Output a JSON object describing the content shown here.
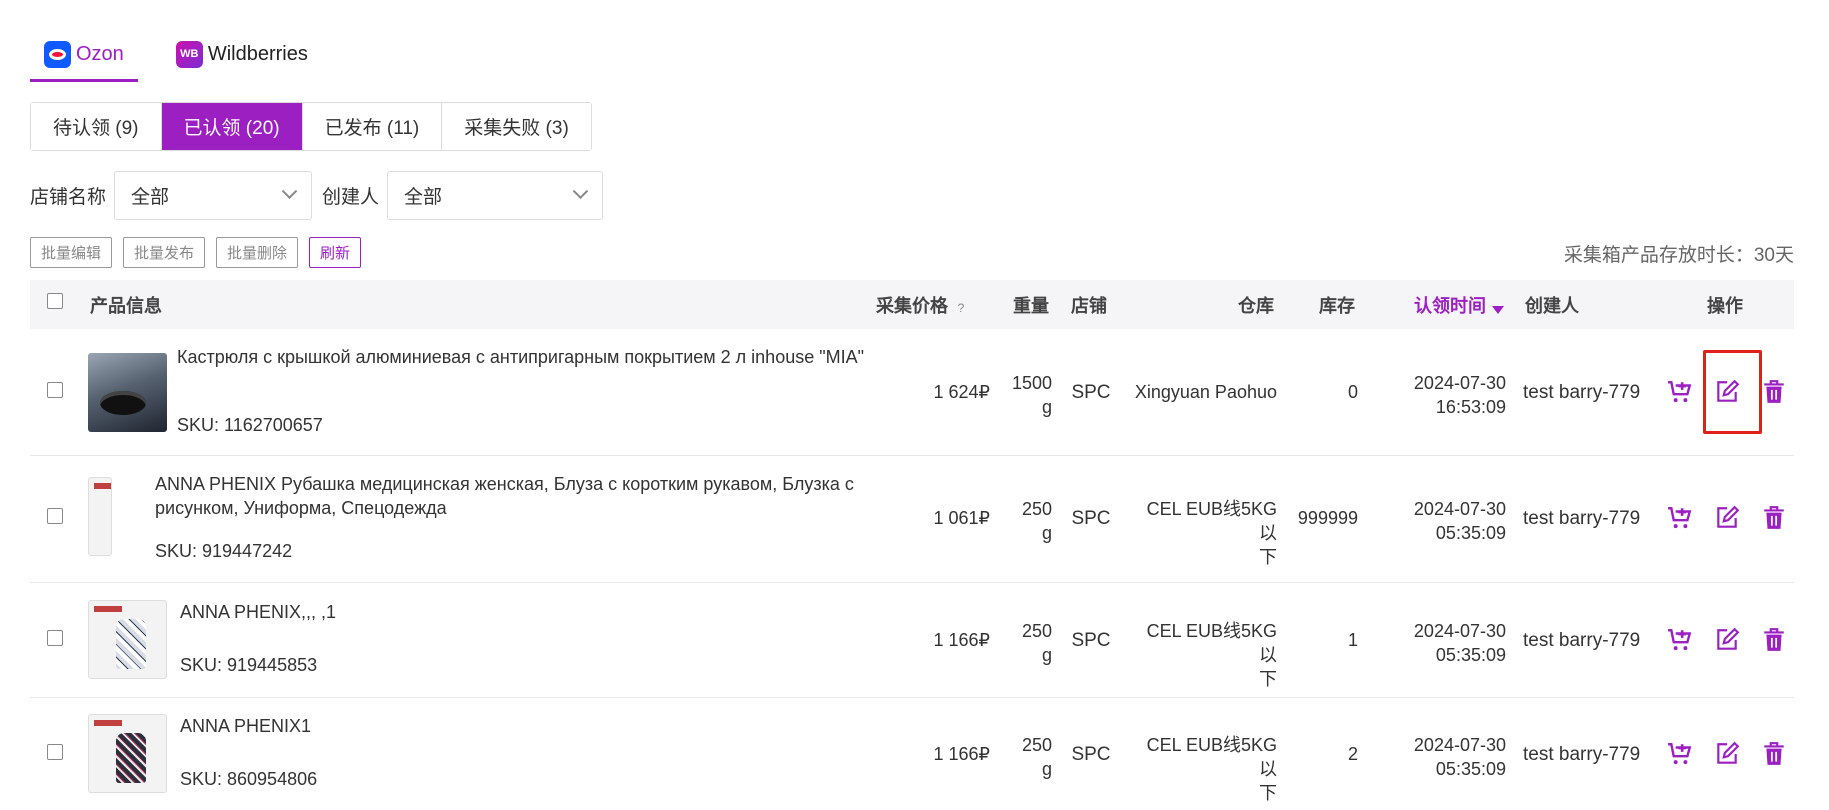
{
  "platform_tabs": [
    {
      "label": "Ozon",
      "logo": "ozon-logo",
      "active": true
    },
    {
      "label": "Wildberries",
      "logo_text": "WB",
      "active": false
    }
  ],
  "status_tabs": [
    {
      "label": "待认领 (9)",
      "active": false
    },
    {
      "label": "已认领 (20)",
      "active": true
    },
    {
      "label": "已发布 (11)",
      "active": false
    },
    {
      "label": "采集失败 (3)",
      "active": false
    }
  ],
  "filters": {
    "shop_label": "店铺名称",
    "shop_value": "全部",
    "creator_label": "创建人",
    "creator_value": "全部"
  },
  "actions": {
    "batch_edit": "批量编辑",
    "batch_publish": "批量发布",
    "batch_delete": "批量删除",
    "refresh": "刷新"
  },
  "storage_note": "采集箱产品存放时长：30天",
  "table": {
    "headers": {
      "product_info": "产品信息",
      "price": "采集价格",
      "price_help": "?",
      "weight": "重量",
      "shop": "店铺",
      "warehouse": "仓库",
      "stock": "库存",
      "claim_time": "认领时间",
      "creator": "创建人",
      "operations": "操作"
    },
    "rows": [
      {
        "name": "Кастрюля с крышкой алюминиевая с антипригарным покрытием 2 л inhouse \"MIA\"",
        "sku": "SKU: 1162700657",
        "price": "1 624₽",
        "weight_value": "1500",
        "weight_unit": "g",
        "shop": "SPC",
        "warehouse": "Xingyuan Paohuo",
        "stock": "0",
        "date": "2024-07-30",
        "time": "16:53:09",
        "creator": "test barry-779"
      },
      {
        "name": "ANNA PHENIX Рубашка медицинская женская, Блуза с коротким рукавом, Блузка с рисунком, Униформа, Спецодежда",
        "sku": "SKU: 919447242",
        "price": "1 061₽",
        "weight_value": "250",
        "weight_unit": "g",
        "shop": "SPC",
        "warehouse_line1": "CEL EUB线5KG以",
        "warehouse_line2": "下",
        "stock": "999999",
        "date": "2024-07-30",
        "time": "05:35:09",
        "creator": "test barry-779"
      },
      {
        "name": "ANNA PHENIX,,, ,1",
        "sku": "SKU: 919445853",
        "price": "1 166₽",
        "weight_value": "250",
        "weight_unit": "g",
        "shop": "SPC",
        "warehouse_line1": "CEL EUB线5KG以",
        "warehouse_line2": "下",
        "stock": "1",
        "date": "2024-07-30",
        "time": "05:35:09",
        "creator": "test barry-779"
      },
      {
        "name": "ANNA PHENIX1",
        "sku": "SKU: 860954806",
        "price": "1 166₽",
        "weight_value": "250",
        "weight_unit": "g",
        "shop": "SPC",
        "warehouse_line1": "CEL EUB线5KG以",
        "warehouse_line2": "下",
        "stock": "2",
        "date": "2024-07-30",
        "time": "05:35:09",
        "creator": "test barry-779"
      }
    ]
  },
  "colors": {
    "accent": "#9c1fc2",
    "highlight": "#e0201c"
  },
  "icons": [
    "add-to-cart-icon",
    "edit-icon",
    "trash-icon"
  ]
}
